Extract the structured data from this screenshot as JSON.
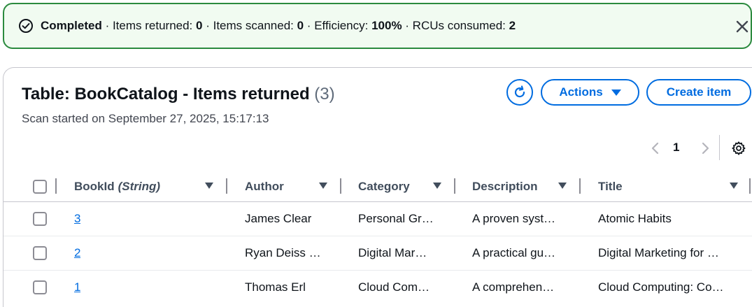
{
  "flash": {
    "status": "Completed",
    "sep": " · ",
    "returned_label": "Items returned: ",
    "returned_value": "0",
    "scanned_label": "Items scanned: ",
    "scanned_value": "0",
    "efficiency_label": "Efficiency: ",
    "efficiency_value": "100%",
    "rcu_label": "RCUs consumed: ",
    "rcu_value": "2",
    "color": "#2b8a3e"
  },
  "panel": {
    "title": "Table: BookCatalog - Items returned",
    "count": "(3)",
    "subtitle": "Scan started on September 27, 2025, 15:17:13",
    "actions_label": "Actions",
    "create_label": "Create item",
    "page": "1",
    "accent": "#006ce0"
  },
  "table": {
    "columns": [
      {
        "label": "BookId",
        "type": "(String)"
      },
      {
        "label": "Author"
      },
      {
        "label": "Category"
      },
      {
        "label": "Description"
      },
      {
        "label": "Title"
      }
    ],
    "rows": [
      {
        "id": "3",
        "author": "James Clear",
        "category": "Personal Gr…",
        "description": "A proven syst…",
        "title": "Atomic Habits"
      },
      {
        "id": "2",
        "author": "Ryan Deiss …",
        "category": "Digital Mar…",
        "description": "A practical gu…",
        "title": "Digital Marketing for …"
      },
      {
        "id": "1",
        "author": "Thomas Erl",
        "category": "Cloud Com…",
        "description": "A comprehen…",
        "title": "Cloud Computing: Co…"
      }
    ]
  },
  "icons": [
    "check-circle-icon",
    "close-icon",
    "refresh-icon",
    "caret-down-icon",
    "chevron-left-icon",
    "chevron-right-icon",
    "gear-icon",
    "sort-caret-icon"
  ]
}
